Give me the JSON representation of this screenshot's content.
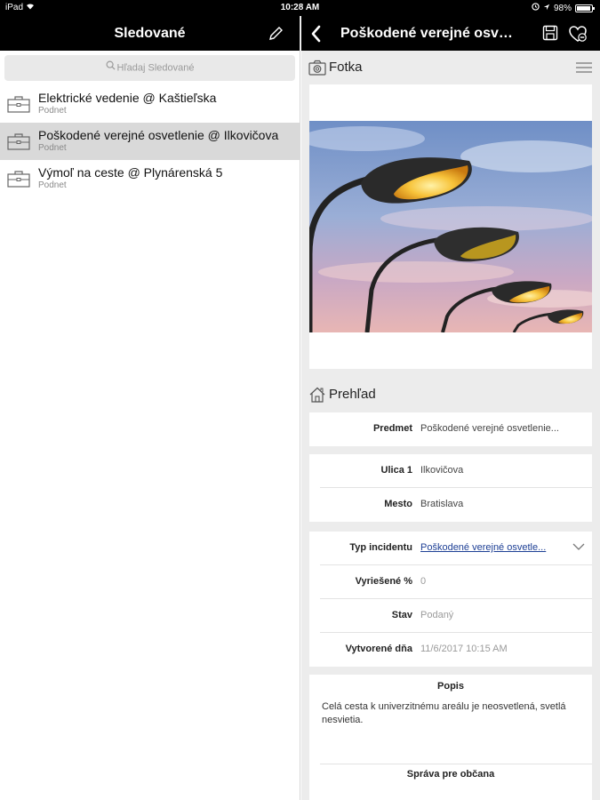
{
  "status_bar": {
    "device": "iPad",
    "time": "10:28 AM",
    "battery": "98%"
  },
  "left_pane": {
    "title": "Sledované",
    "search_placeholder": "Hľadaj Sledované",
    "items": [
      {
        "title": "Elektrické vedenie @ Kaštieľska",
        "subtitle": "Podnet",
        "selected": false
      },
      {
        "title": "Poškodené verejné osvetlenie @ Ilkovičova",
        "subtitle": "Podnet",
        "selected": true
      },
      {
        "title": "Výmoľ na ceste @ Plynárenská 5",
        "subtitle": "Podnet",
        "selected": false
      }
    ]
  },
  "right_pane": {
    "title": "Poškodené verejné osvetlenie",
    "photo_section": {
      "label": "Fotka"
    },
    "overview_section": {
      "label": "Prehľad"
    },
    "card1": [
      {
        "label": "Predmet",
        "value": "Poškodené verejné osvetlenie..."
      }
    ],
    "card2": [
      {
        "label": "Ulica 1",
        "value": "Ilkovičova"
      },
      {
        "label": "Mesto",
        "value": "Bratislava"
      }
    ],
    "card3": [
      {
        "label": "Typ incidentu",
        "value": "Poškodené verejné osvetle..."
      },
      {
        "label": "Vyriešené %",
        "value": "0"
      },
      {
        "label": "Stav",
        "value": "Podaný"
      },
      {
        "label": "Vytvorené dňa",
        "value": "11/6/2017 10:15 AM"
      }
    ],
    "description": {
      "title": "Popis",
      "text": "Celá cesta k univerzitnému areálu je neosvetlená, svetlá nesvietia.",
      "next_section_title": "Správa pre občana"
    }
  }
}
